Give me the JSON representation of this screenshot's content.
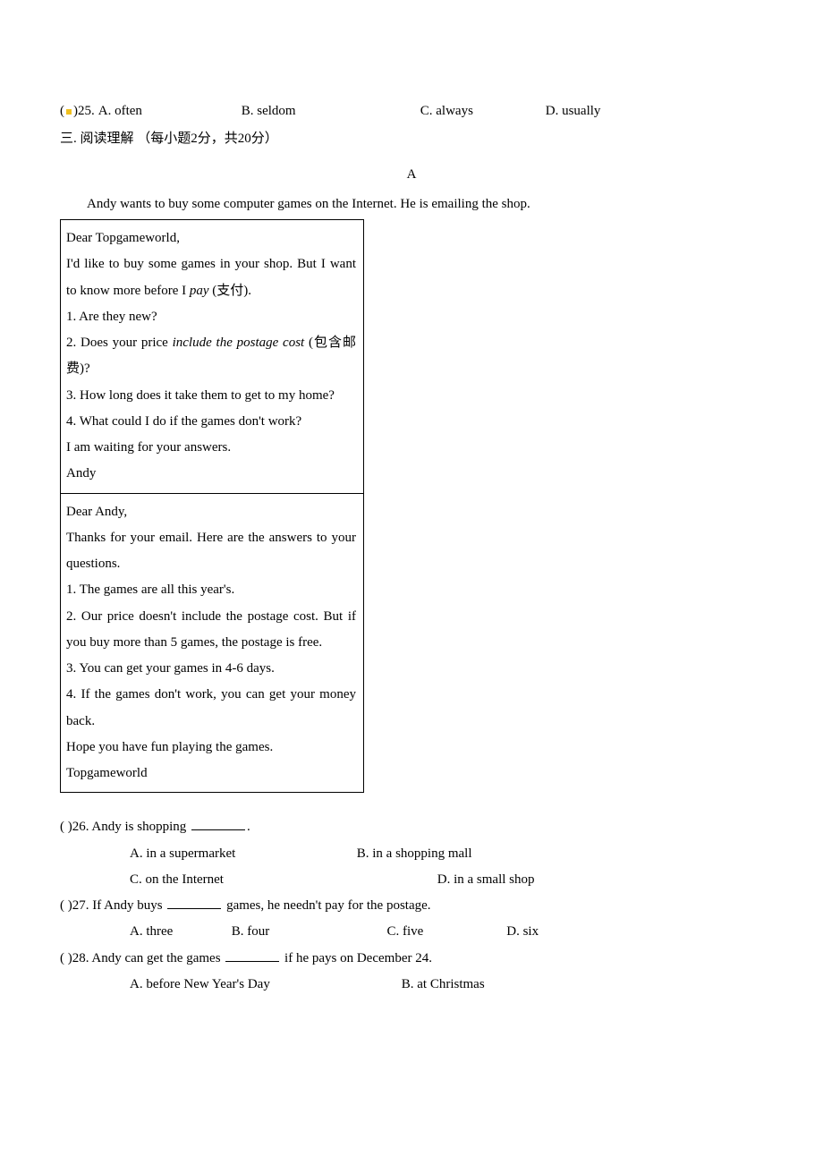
{
  "q25": {
    "marker": "(",
    "marker2": ")25.",
    "A": "A. often",
    "B": "B. seldom",
    "C": "C. always",
    "D": "D. usually"
  },
  "section3": {
    "title": "三. 阅读理解 （每小题2分，共20分）",
    "passageLabel": "A",
    "intro": "Andy wants to buy some computer games on the Internet. He is emailing the shop."
  },
  "email1": {
    "greeting": "Dear Topgameworld,",
    "l1a": "I'd like to buy some games in your shop. But I want to know more before I ",
    "l1_pay": "pay",
    "l1b": " (支付).",
    "q1": "1. Are they new?",
    "q2a": "2. Does your price ",
    "q2_italic": "include the postage cost",
    "q2b": " (包含邮费)?",
    "q3": "3. How long does it take them to get to my home?",
    "q4": "4. What could I do if the games don't work?",
    "closing": "I am waiting for your answers.",
    "sig": "Andy"
  },
  "email2": {
    "greeting": "Dear Andy,",
    "l1": "Thanks for your email. Here are the answers to your questions.",
    "a1": "1. The games are all this year's.",
    "a2": "2. Our price doesn't include the postage cost. But if you buy more than 5 games, the postage is free.",
    "a3": "3. You can get your games in 4-6 days.",
    "a4": "4. If the games don't work, you can get your money back.",
    "closing": "Hope you have fun playing the games.",
    "sig": "Topgameworld"
  },
  "q26": {
    "stem_pre": "(   )26. Andy is shopping ",
    "stem_post": ".",
    "A": "A. in a supermarket",
    "B": "B. in a shopping mall",
    "C": "C. on the Internet",
    "D": "D. in a small shop"
  },
  "q27": {
    "stem_pre": "(   )27. If Andy buys ",
    "stem_post": " games, he needn't pay for the postage.",
    "A": "A. three",
    "B": "B. four",
    "C": "C. five",
    "D": "D. six"
  },
  "q28": {
    "stem_pre": "(   )28. Andy can get the games ",
    "stem_post": " if he pays on December 24.",
    "A": "A. before New Year's Day",
    "B": "B. at Christmas"
  }
}
